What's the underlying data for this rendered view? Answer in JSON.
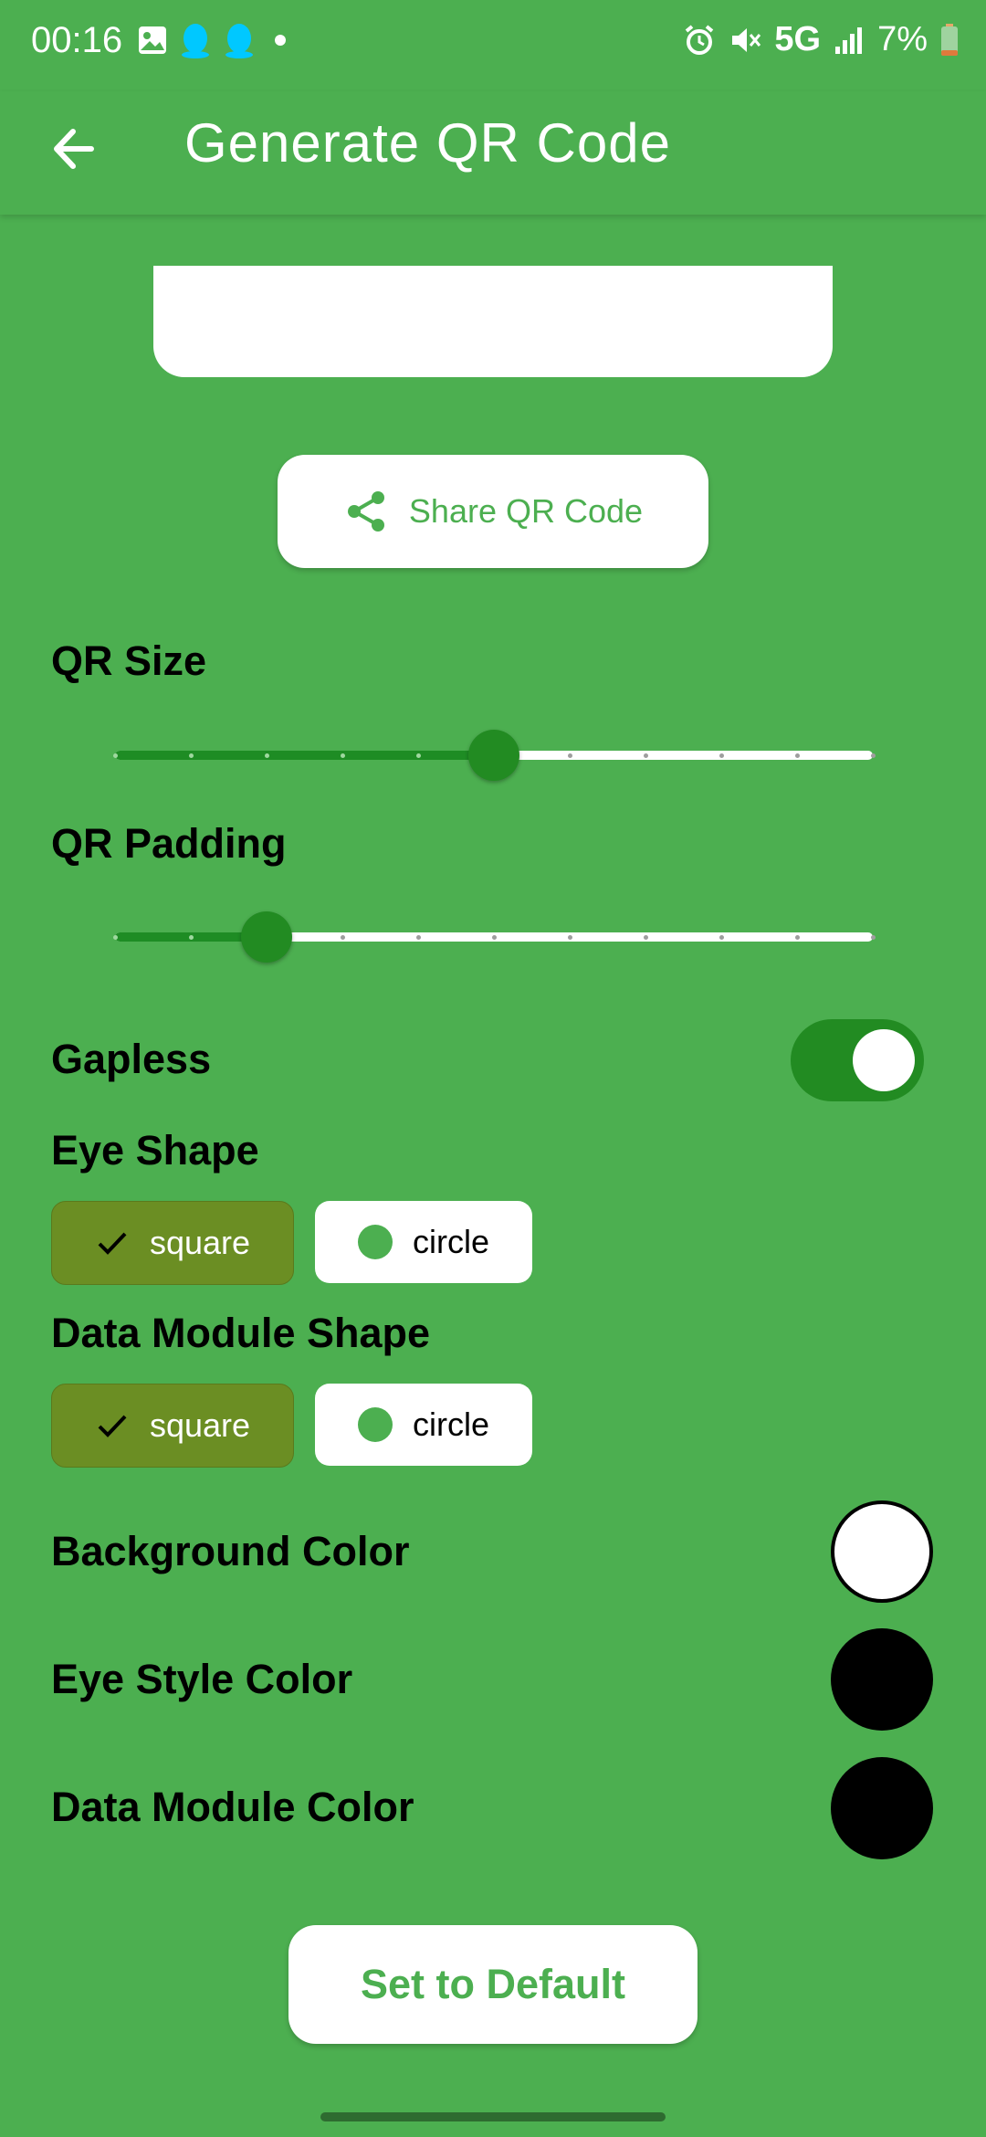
{
  "status_bar": {
    "time": "00:16",
    "network": "5G",
    "battery": "7%",
    "icons_left": [
      "image-icon",
      "qq-icon",
      "qq-icon",
      "dot-icon"
    ],
    "icons_right": [
      "alarm-icon",
      "mute-icon",
      "signal-icon",
      "battery-icon"
    ]
  },
  "app_bar": {
    "title": "Generate QR Code",
    "back_icon": "arrow-back-icon"
  },
  "share_button": {
    "label": "Share QR Code",
    "icon": "share-icon"
  },
  "qr_size": {
    "label": "QR Size",
    "value_fraction": 0.5,
    "divisions": 10
  },
  "qr_padding": {
    "label": "QR Padding",
    "value_fraction": 0.2,
    "divisions": 10
  },
  "gapless": {
    "label": "Gapless",
    "on": true
  },
  "eye_shape": {
    "label": "Eye Shape",
    "options": [
      {
        "label": "square",
        "selected": true
      },
      {
        "label": "circle",
        "selected": false
      }
    ]
  },
  "data_module_shape": {
    "label": "Data Module Shape",
    "options": [
      {
        "label": "square",
        "selected": true
      },
      {
        "label": "circle",
        "selected": false
      }
    ]
  },
  "background_color": {
    "label": "Background Color",
    "color": "#ffffff"
  },
  "eye_style_color": {
    "label": "Eye Style Color",
    "color": "#000000"
  },
  "data_module_color": {
    "label": "Data Module Color",
    "color": "#000000"
  },
  "default_button": {
    "label": "Set to Default"
  },
  "colors": {
    "background": "#4caf50",
    "accent_dark": "#228b22",
    "chip_selected": "#6b8e23"
  }
}
